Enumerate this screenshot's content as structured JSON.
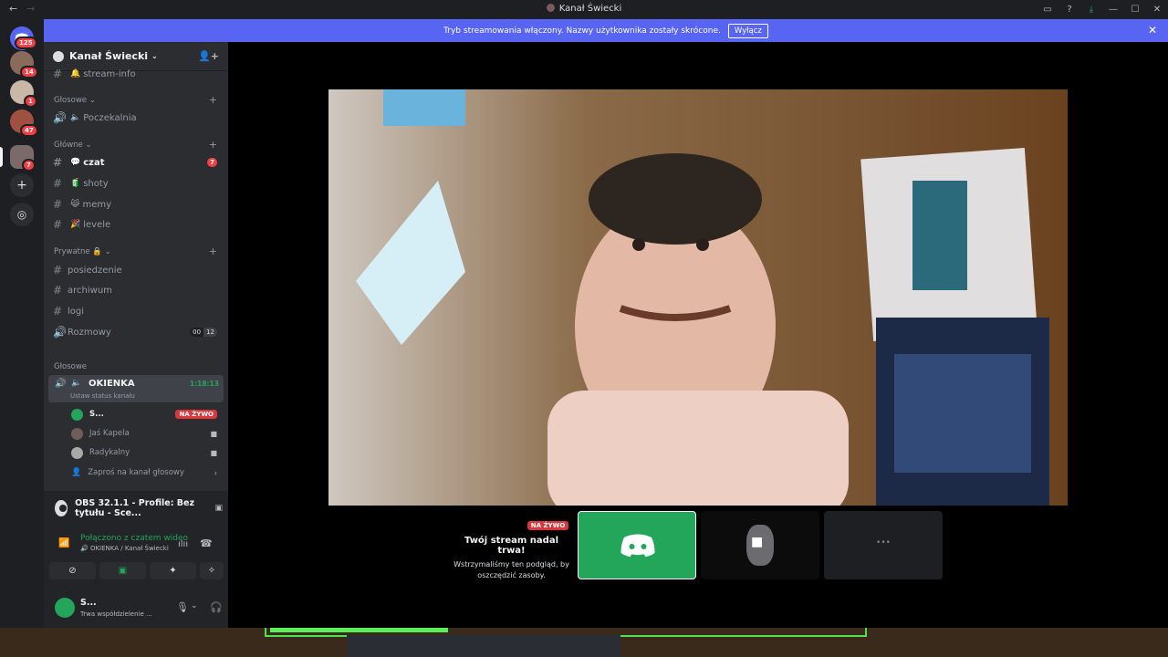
{
  "window": {
    "title": "Kanał Świecki",
    "back": "←",
    "forward": "→"
  },
  "guilds": {
    "badges": [
      "125",
      "14",
      "1",
      "47",
      "7"
    ]
  },
  "banner": {
    "text": "Tryb streamowania włączony. Nazwy użytkownika zostały skrócone.",
    "button": "Wyłącz"
  },
  "server": {
    "name": "Kanał Świecki"
  },
  "channels": {
    "stream_info": "stream-info",
    "cat_glosowe1": "Głosowe",
    "poczekalnia": "Poczekalnia",
    "cat_glowne": "Główne",
    "czat": "czat",
    "czat_count": "7",
    "shoty": "shoty",
    "memy": "memy",
    "levele": "levele",
    "cat_prywatne": "Prywatne 🔒",
    "posiedzenie": "posiedzenie",
    "archiwum": "archiwum",
    "logi": "logi",
    "rozmowy": "Rozmowy",
    "rozmowy_users": [
      "00",
      "12"
    ],
    "cat_glosowe2": "Głosowe",
    "okienka": "OKIENKA",
    "okienka_timer": "1:18:13",
    "okienka_status": "Ustaw status kanału",
    "voice_users": [
      {
        "name": "S...",
        "live": "NA ŻYWO"
      },
      {
        "name": "Jaś Kapela"
      },
      {
        "name": "Radykalny"
      }
    ],
    "invite": "Zaproś na kanał głosowy"
  },
  "panel": {
    "obs_title": "OBS 32.1.1 - Profile: Bez tytułu - Sce...",
    "connected": "Połączono z czatem wideo",
    "connected_sub": "OKIENKA / Kanał Świecki",
    "user_name": "S...",
    "user_status": "Trwa współdzielenie ..."
  },
  "stream": {
    "live_badge": "NA ŻYWO",
    "title": "Twój stream nadal trwa!",
    "subtitle": "Wstrzymaliśmy ten podgląd, by oszczędzić zasoby.",
    "more": "•••"
  },
  "colors": {
    "brand": "#5865f2",
    "green": "#23a55a",
    "red": "#da373c"
  }
}
